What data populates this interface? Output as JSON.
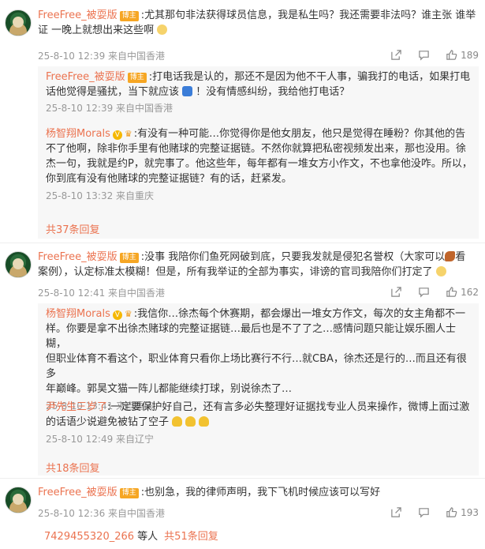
{
  "comments": [
    {
      "user": "FreeFree_被耍版",
      "badge": "博主",
      "text_line1": ":尤其那句非法获得球员信息，我是私生吗？我还需要非法吗？谁主张 谁举",
      "text_line2": "证 一晚上就想出来这些啊",
      "time": "25-8-10 12:39 来自中国香港",
      "likes": "189",
      "replies": [
        {
          "user": "FreeFree_被耍版",
          "badge": "博主",
          "text_line1": ":打电话我是认的，那还不是因为他不干人事，骗我打的电话，如果打电",
          "text_line2": "话他觉得是骚扰，当下就应该",
          "text_line2b": "！没有情感纠纷，我给他打电话？",
          "time": "25-8-10 12:39 来自中国香港"
        },
        {
          "user": "杨智翔Morals",
          "text_lines": [
            ":有没有一种可能…你觉得你是他女朋友，他只是觉得在睡粉？你其他的告",
            "不了他啊，除非你手里有他赌球的完整证据链。不然你就算把私密视频发出来，那也没用。徐",
            "杰一句，我就是约P，就完事了。他这些年，每年都有一堆女方小作文，不也拿他没咋。所以，",
            "你到底有没有他赌球的完整证据链？有的话，赶紧发。"
          ],
          "time": "25-8-10 13:32 来自重庆"
        }
      ],
      "more": "共37条回复"
    },
    {
      "user": "FreeFree_被耍版",
      "badge": "博主",
      "text_line1": ":没事 我陪你们鱼死网破到底，只要我发就是侵犯名誉权（大家可以",
      "text_line1b": "看",
      "text_line2": "案例），认定标准太模糊！但是，所有我举证的全部为事实，诽谤的官司我陪你们打定了",
      "time": "25-8-10 12:41 来自中国香港",
      "likes": "162",
      "replies": [
        {
          "user": "杨智翔Morals",
          "text_lines": [
            ":我信你…徐杰每个休赛期，都会爆出一堆女方作文，每次的女主角都不一",
            "样。你要是拿不出徐杰赌球的完整证据链…最后也是不了了之…感情问题只能让娱乐圈人士糊，",
            "但职业体育不看这个，职业体育只看你上场比赛行不行…就CBA，徐杰还是行的…而且还有很多",
            "年巅峰。郭昊文猫一阵儿都能继续打球，别说徐杰了…"
          ],
          "time": "25-8-10 13:41 来自重庆"
        },
        {
          "user": "尹先生三岁了",
          "text_lines": [
            ":一定要保护好自己，还有言多必失整理好证据找专业人员来操作，微博上面过激",
            "的话语少说避免被钻了空子"
          ],
          "time": "25-8-10 12:49 来自辽宁"
        }
      ],
      "more": "共18条回复"
    },
    {
      "user": "FreeFree_被耍版",
      "badge": "博主",
      "text_line1": ":也别急，我的律师声明，我下飞机时候应该可以写好",
      "time": "25-8-10 12:36 来自中国香港",
      "likes": "193"
    }
  ],
  "bottom": {
    "user": "7429455320_266",
    "suffix": " 等人",
    "more": "共51条回复"
  },
  "icons": [
    "share-icon",
    "comment-icon",
    "like-icon",
    "crown-icon",
    "vip-icon"
  ],
  "colors": {
    "link": "#eb7350",
    "meta": "#999999",
    "reply_bg": "#f7f7f7",
    "badge": "#f6a623"
  }
}
